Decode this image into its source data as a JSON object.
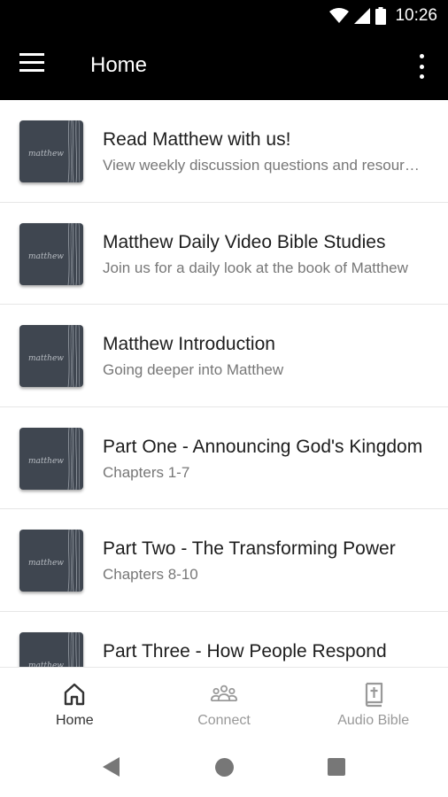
{
  "status_bar": {
    "time": "10:26"
  },
  "app_bar": {
    "title": "Home"
  },
  "items": [
    {
      "title": "Read Matthew with us!",
      "subtitle": "View weekly discussion questions and resources"
    },
    {
      "title": "Matthew Daily Video Bible Studies",
      "subtitle": "Join us for a daily look at the book of Matthew"
    },
    {
      "title": "Matthew Introduction",
      "subtitle": "Going deeper into Matthew"
    },
    {
      "title": "Part One - Announcing God's Kingdom",
      "subtitle": "Chapters 1-7"
    },
    {
      "title": "Part Two - The Transforming Power",
      "subtitle": "Chapters 8-10"
    },
    {
      "title": "Part Three - How People Respond",
      "subtitle": ""
    }
  ],
  "thumbnail": {
    "script_text": "matthew",
    "bg_color": "#3f4650"
  },
  "bottom_nav": [
    {
      "label": "Home",
      "icon": "home-icon",
      "active": true
    },
    {
      "label": "Connect",
      "icon": "people-icon",
      "active": false
    },
    {
      "label": "Audio Bible",
      "icon": "bible-icon",
      "active": false
    }
  ]
}
